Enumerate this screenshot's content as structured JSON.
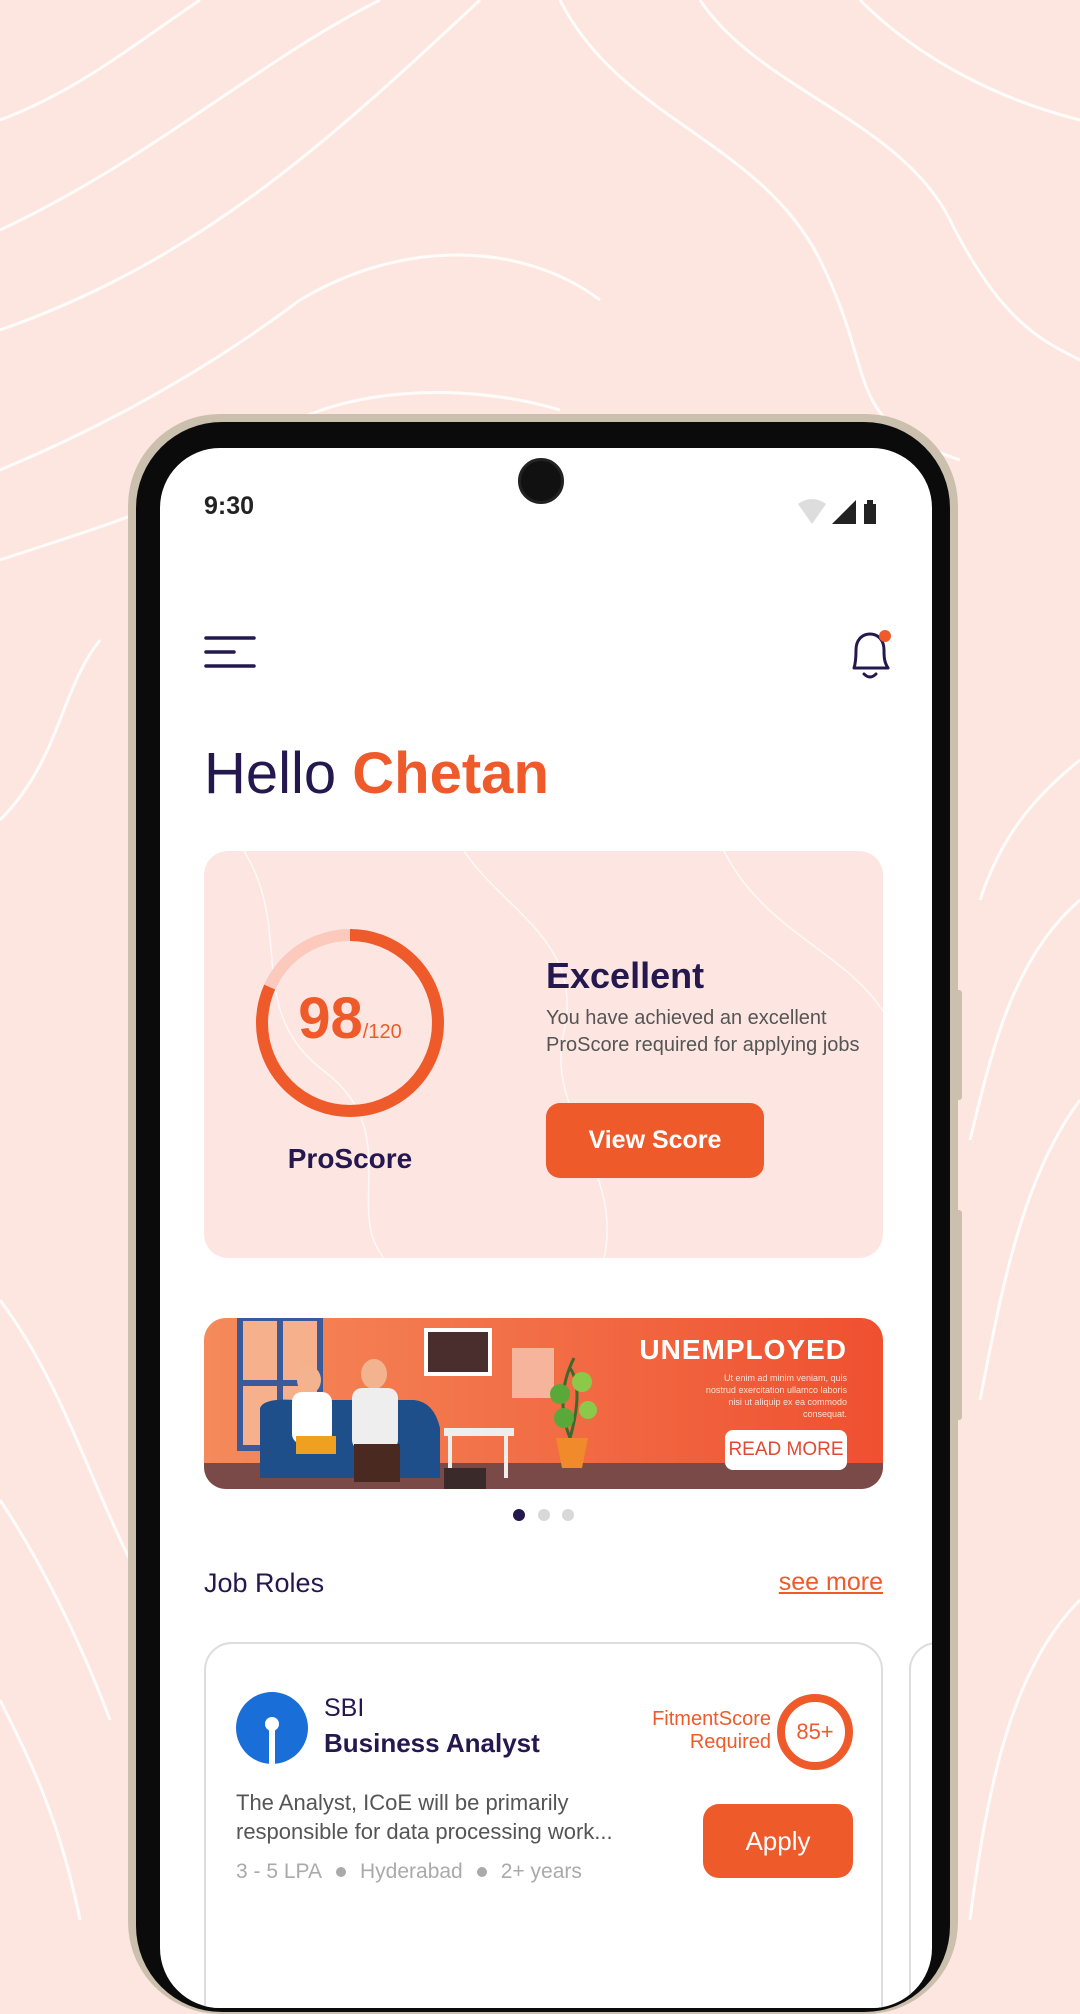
{
  "status_bar": {
    "time": "9:30"
  },
  "greeting": {
    "hello": "Hello",
    "name": "Chetan"
  },
  "proscore": {
    "score": "98",
    "max": "/120",
    "value": 98,
    "out_of": 120,
    "label": "ProScore",
    "rating": "Excellent",
    "description": "You have achieved an excellent ProScore required for applying jobs",
    "button": "View Score"
  },
  "banner": {
    "title": "UNEMPLOYED",
    "body": "Ut enim ad minim veniam, quis nostrud exercitation ullamco laboris nisi ut aliquip ex ea commodo consequat.",
    "button": "READ MORE",
    "active_dot": 0,
    "dot_count": 3
  },
  "job_roles": {
    "title": "Job Roles",
    "see_more": "see more",
    "jobs": [
      {
        "company": "SBI",
        "role": "Business Analyst",
        "fitment_label_1": "FitmentScore",
        "fitment_label_2": "Required",
        "fitment": "85+",
        "description": "The Analyst, ICoE will be primarily responsible for data processing work...",
        "salary": "3 - 5 LPA",
        "location": "Hyderabad",
        "experience": "2+ years",
        "apply": "Apply"
      }
    ]
  },
  "colors": {
    "accent": "#ef5a2b",
    "navy": "#24184f",
    "card_bg": "#fde6e2",
    "background": "#fde6df"
  },
  "icons": {
    "menu": "menu-icon",
    "notification": "bell-icon"
  }
}
